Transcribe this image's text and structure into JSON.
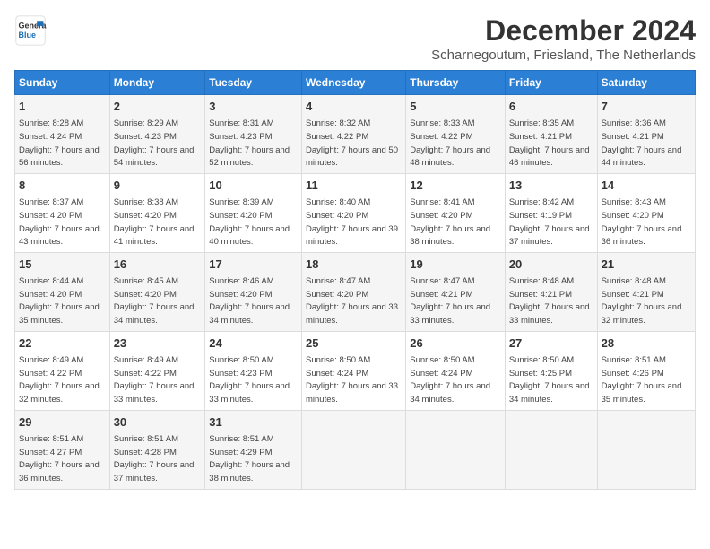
{
  "logo": {
    "line1": "General",
    "line2": "Blue"
  },
  "title": "December 2024",
  "subtitle": "Scharnegoutum, Friesland, The Netherlands",
  "headers": [
    "Sunday",
    "Monday",
    "Tuesday",
    "Wednesday",
    "Thursday",
    "Friday",
    "Saturday"
  ],
  "weeks": [
    [
      {
        "day": "1",
        "sunrise": "8:28 AM",
        "sunset": "4:24 PM",
        "daylight": "7 hours and 56 minutes."
      },
      {
        "day": "2",
        "sunrise": "8:29 AM",
        "sunset": "4:23 PM",
        "daylight": "7 hours and 54 minutes."
      },
      {
        "day": "3",
        "sunrise": "8:31 AM",
        "sunset": "4:23 PM",
        "daylight": "7 hours and 52 minutes."
      },
      {
        "day": "4",
        "sunrise": "8:32 AM",
        "sunset": "4:22 PM",
        "daylight": "7 hours and 50 minutes."
      },
      {
        "day": "5",
        "sunrise": "8:33 AM",
        "sunset": "4:22 PM",
        "daylight": "7 hours and 48 minutes."
      },
      {
        "day": "6",
        "sunrise": "8:35 AM",
        "sunset": "4:21 PM",
        "daylight": "7 hours and 46 minutes."
      },
      {
        "day": "7",
        "sunrise": "8:36 AM",
        "sunset": "4:21 PM",
        "daylight": "7 hours and 44 minutes."
      }
    ],
    [
      {
        "day": "8",
        "sunrise": "8:37 AM",
        "sunset": "4:20 PM",
        "daylight": "7 hours and 43 minutes."
      },
      {
        "day": "9",
        "sunrise": "8:38 AM",
        "sunset": "4:20 PM",
        "daylight": "7 hours and 41 minutes."
      },
      {
        "day": "10",
        "sunrise": "8:39 AM",
        "sunset": "4:20 PM",
        "daylight": "7 hours and 40 minutes."
      },
      {
        "day": "11",
        "sunrise": "8:40 AM",
        "sunset": "4:20 PM",
        "daylight": "7 hours and 39 minutes."
      },
      {
        "day": "12",
        "sunrise": "8:41 AM",
        "sunset": "4:20 PM",
        "daylight": "7 hours and 38 minutes."
      },
      {
        "day": "13",
        "sunrise": "8:42 AM",
        "sunset": "4:19 PM",
        "daylight": "7 hours and 37 minutes."
      },
      {
        "day": "14",
        "sunrise": "8:43 AM",
        "sunset": "4:20 PM",
        "daylight": "7 hours and 36 minutes."
      }
    ],
    [
      {
        "day": "15",
        "sunrise": "8:44 AM",
        "sunset": "4:20 PM",
        "daylight": "7 hours and 35 minutes."
      },
      {
        "day": "16",
        "sunrise": "8:45 AM",
        "sunset": "4:20 PM",
        "daylight": "7 hours and 34 minutes."
      },
      {
        "day": "17",
        "sunrise": "8:46 AM",
        "sunset": "4:20 PM",
        "daylight": "7 hours and 34 minutes."
      },
      {
        "day": "18",
        "sunrise": "8:47 AM",
        "sunset": "4:20 PM",
        "daylight": "7 hours and 33 minutes."
      },
      {
        "day": "19",
        "sunrise": "8:47 AM",
        "sunset": "4:21 PM",
        "daylight": "7 hours and 33 minutes."
      },
      {
        "day": "20",
        "sunrise": "8:48 AM",
        "sunset": "4:21 PM",
        "daylight": "7 hours and 33 minutes."
      },
      {
        "day": "21",
        "sunrise": "8:48 AM",
        "sunset": "4:21 PM",
        "daylight": "7 hours and 32 minutes."
      }
    ],
    [
      {
        "day": "22",
        "sunrise": "8:49 AM",
        "sunset": "4:22 PM",
        "daylight": "7 hours and 32 minutes."
      },
      {
        "day": "23",
        "sunrise": "8:49 AM",
        "sunset": "4:22 PM",
        "daylight": "7 hours and 33 minutes."
      },
      {
        "day": "24",
        "sunrise": "8:50 AM",
        "sunset": "4:23 PM",
        "daylight": "7 hours and 33 minutes."
      },
      {
        "day": "25",
        "sunrise": "8:50 AM",
        "sunset": "4:24 PM",
        "daylight": "7 hours and 33 minutes."
      },
      {
        "day": "26",
        "sunrise": "8:50 AM",
        "sunset": "4:24 PM",
        "daylight": "7 hours and 34 minutes."
      },
      {
        "day": "27",
        "sunrise": "8:50 AM",
        "sunset": "4:25 PM",
        "daylight": "7 hours and 34 minutes."
      },
      {
        "day": "28",
        "sunrise": "8:51 AM",
        "sunset": "4:26 PM",
        "daylight": "7 hours and 35 minutes."
      }
    ],
    [
      {
        "day": "29",
        "sunrise": "8:51 AM",
        "sunset": "4:27 PM",
        "daylight": "7 hours and 36 minutes."
      },
      {
        "day": "30",
        "sunrise": "8:51 AM",
        "sunset": "4:28 PM",
        "daylight": "7 hours and 37 minutes."
      },
      {
        "day": "31",
        "sunrise": "8:51 AM",
        "sunset": "4:29 PM",
        "daylight": "7 hours and 38 minutes."
      },
      null,
      null,
      null,
      null
    ]
  ]
}
